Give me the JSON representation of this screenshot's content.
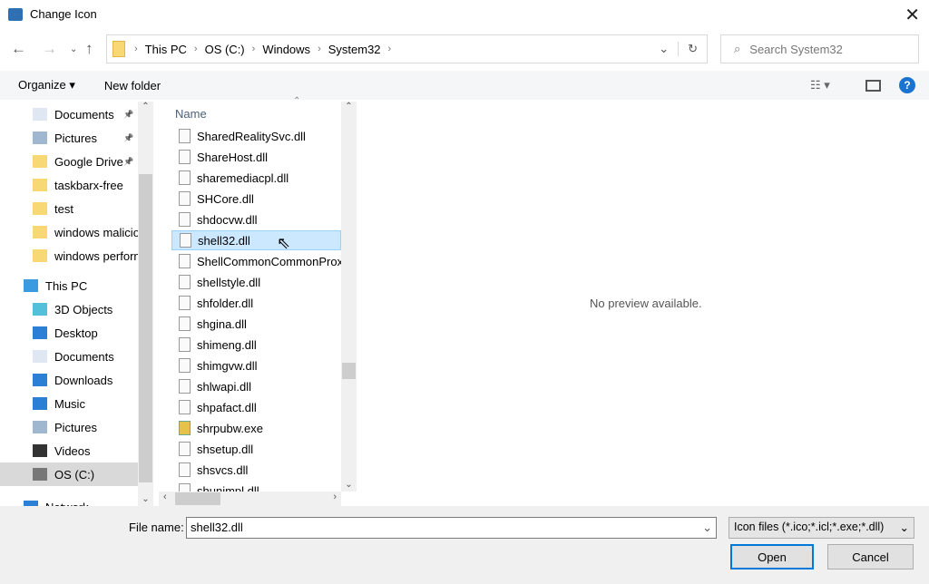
{
  "window": {
    "title": "Change Icon"
  },
  "address": {
    "crumbs": [
      "This PC",
      "OS (C:)",
      "Windows",
      "System32"
    ],
    "search_placeholder": "Search System32"
  },
  "toolbar": {
    "organize": "Organize ▾",
    "new_folder": "New folder"
  },
  "nav": {
    "items": [
      {
        "label": "Documents",
        "pinned": true
      },
      {
        "label": "Pictures",
        "pinned": true
      },
      {
        "label": "Google Drive",
        "pinned": true
      },
      {
        "label": "taskbarx-free"
      },
      {
        "label": "test"
      },
      {
        "label": "windows malicious"
      },
      {
        "label": "windows performance"
      },
      {
        "label": "This PC"
      },
      {
        "label": "3D Objects"
      },
      {
        "label": "Desktop"
      },
      {
        "label": "Documents"
      },
      {
        "label": "Downloads"
      },
      {
        "label": "Music"
      },
      {
        "label": "Pictures"
      },
      {
        "label": "Videos"
      },
      {
        "label": "OS (C:)"
      },
      {
        "label": "Network"
      }
    ]
  },
  "files": {
    "column": "Name",
    "items": [
      "SharedRealitySvc.dll",
      "ShareHost.dll",
      "sharemediacpl.dll",
      "SHCore.dll",
      "shdocvw.dll",
      "shell32.dll",
      "ShellCommonCommonProxy",
      "shellstyle.dll",
      "shfolder.dll",
      "shgina.dll",
      "shimeng.dll",
      "shimgvw.dll",
      "shlwapi.dll",
      "shpafact.dll",
      "shrpubw.exe",
      "shsetup.dll",
      "shsvcs.dll",
      "shunimpl.dll"
    ],
    "selected": "shell32.dll"
  },
  "preview": {
    "text": "No preview available."
  },
  "footer": {
    "file_name_label": "File name:",
    "file_name": "shell32.dll",
    "filter": "Icon files (*.ico;*.icl;*.exe;*.dll)",
    "open": "Open",
    "cancel": "Cancel"
  }
}
